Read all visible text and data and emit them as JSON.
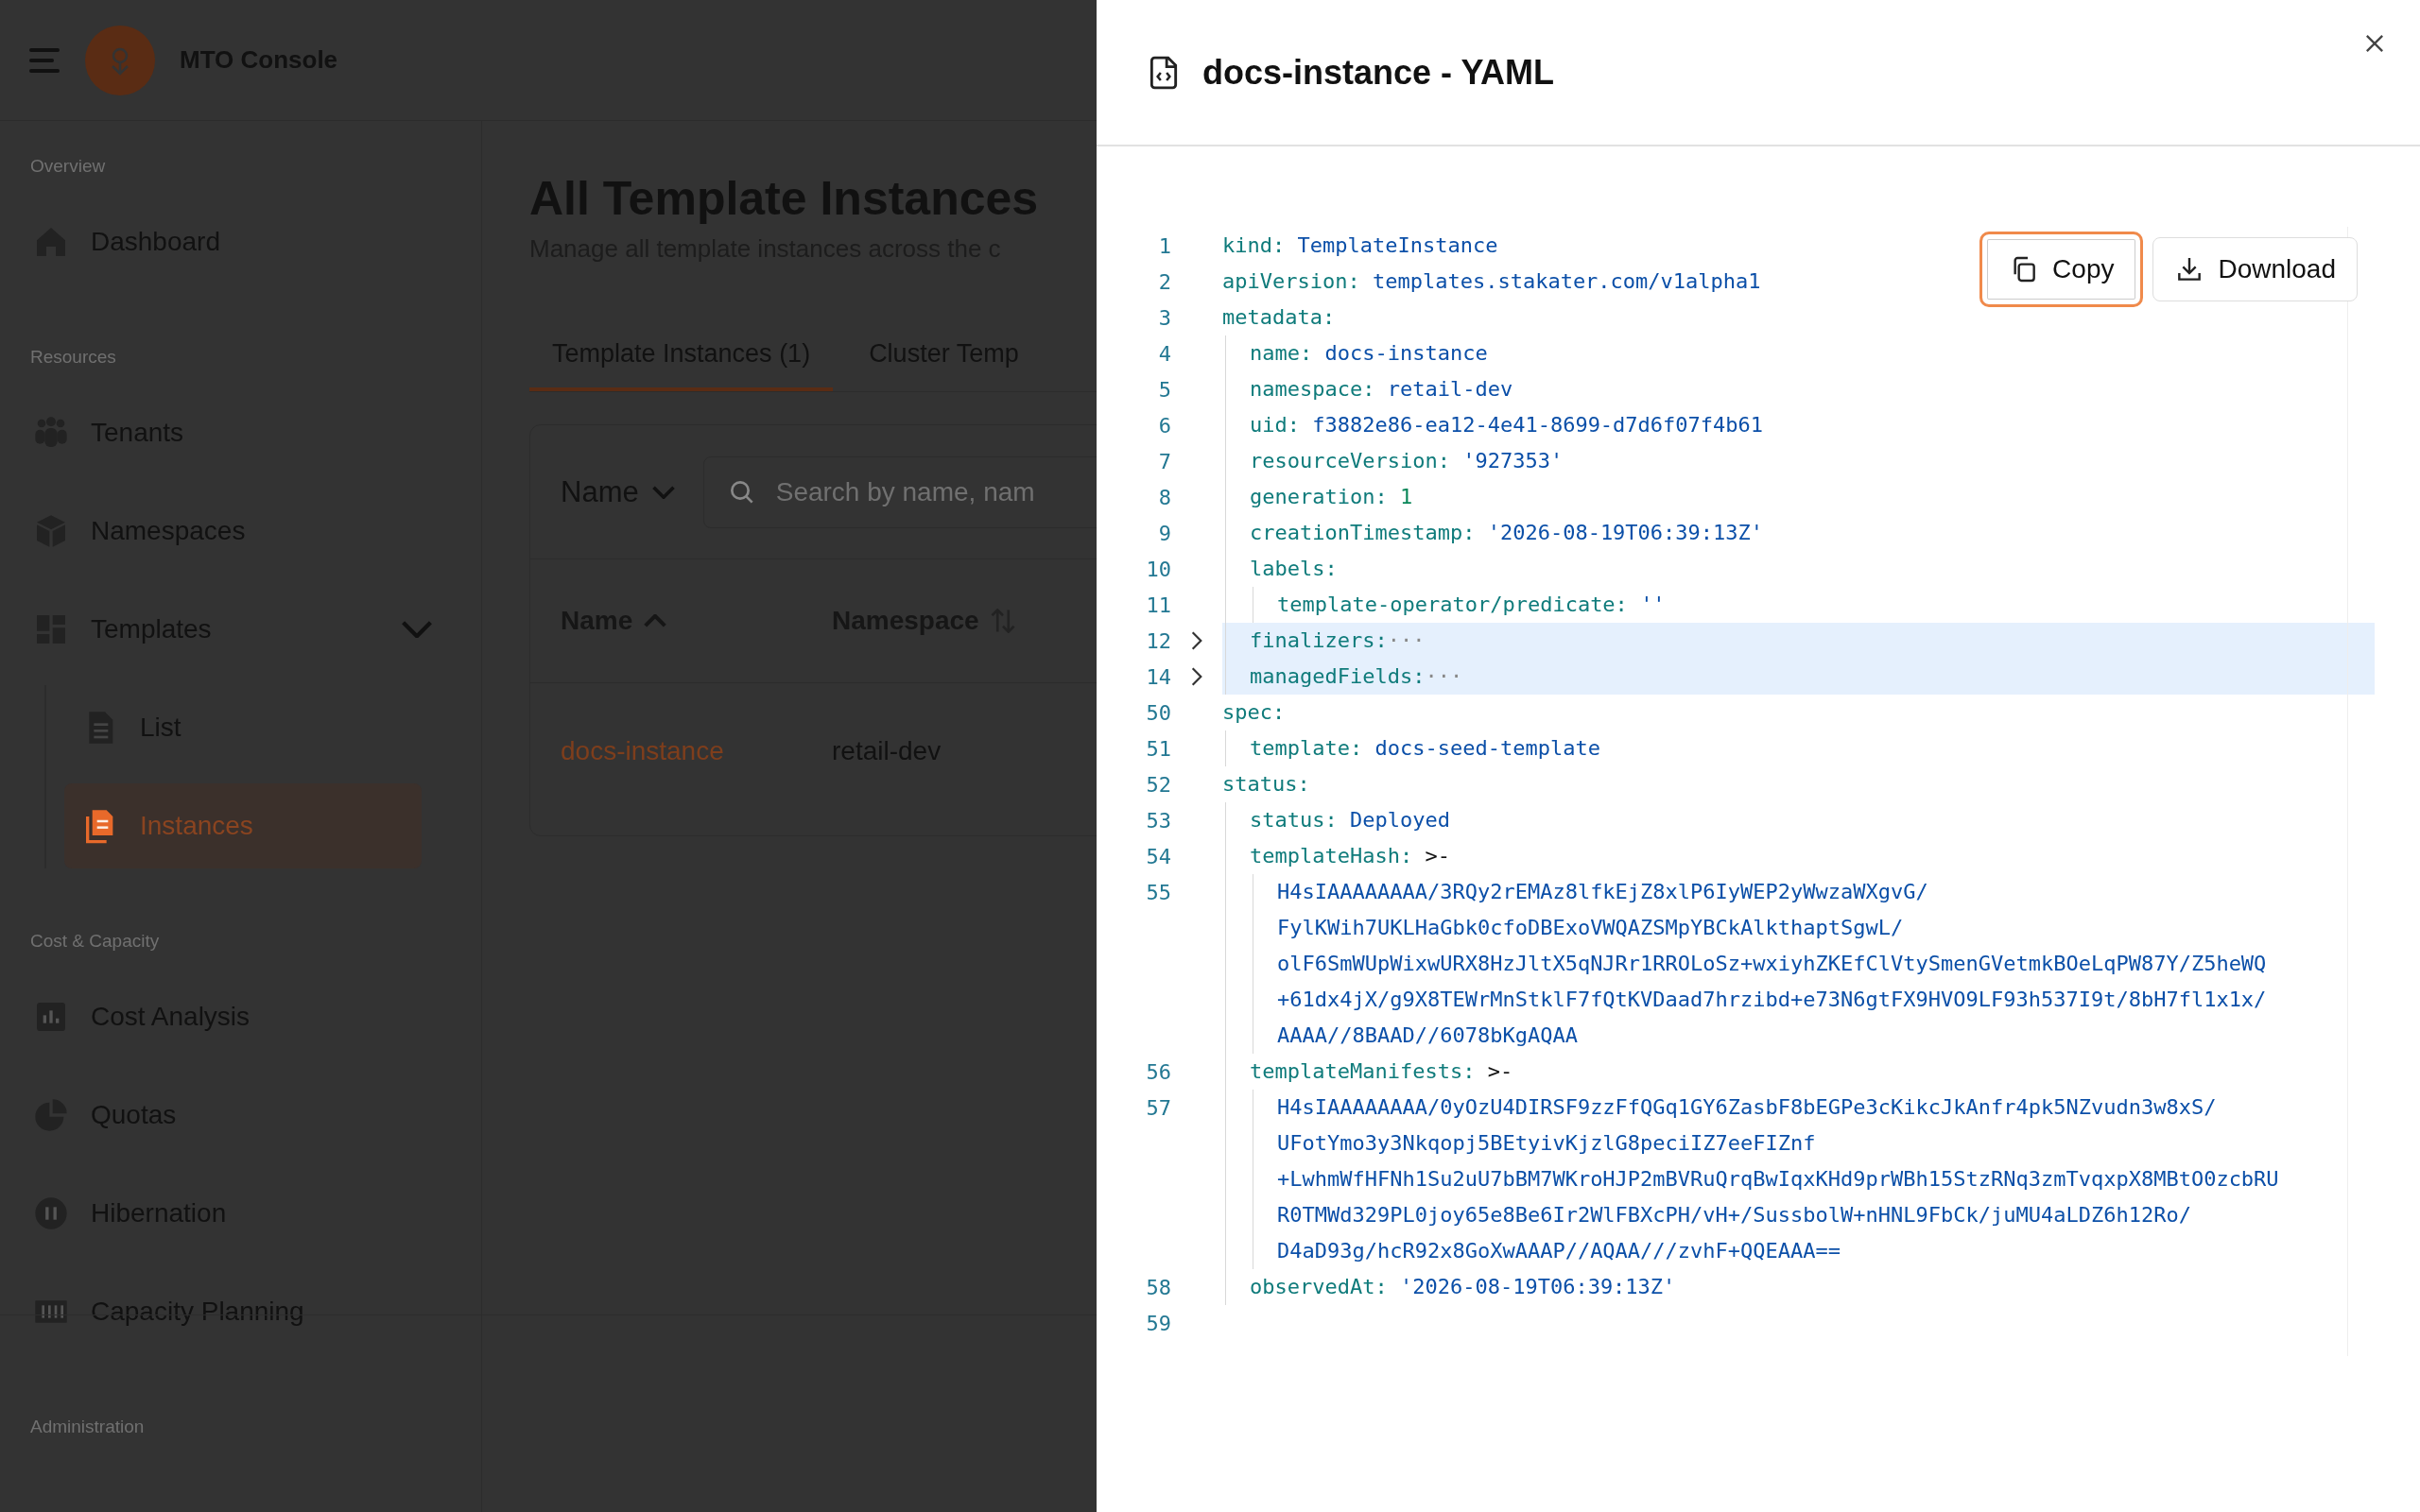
{
  "app": {
    "brand": "MTO Console",
    "sidebar": {
      "sections": [
        {
          "label": "Overview",
          "items": [
            {
              "label": "Dashboard",
              "selected": false
            }
          ]
        },
        {
          "label": "Resources",
          "items": [
            {
              "label": "Tenants",
              "selected": false
            },
            {
              "label": "Namespaces",
              "selected": false
            },
            {
              "label": "Templates",
              "selected": false,
              "expanded": true,
              "children": [
                {
                  "label": "List",
                  "selected": false
                },
                {
                  "label": "Instances",
                  "selected": true
                }
              ]
            }
          ]
        },
        {
          "label": "Cost & Capacity",
          "items": [
            {
              "label": "Cost Analysis",
              "selected": false
            },
            {
              "label": "Quotas",
              "selected": false
            },
            {
              "label": "Hibernation",
              "selected": false
            },
            {
              "label": "Capacity Planning",
              "selected": false
            }
          ]
        },
        {
          "label": "Administration"
        }
      ]
    },
    "page": {
      "title": "All Template Instances",
      "subtitle": "Manage all template instances across the c",
      "tabs": [
        {
          "label": "Template Instances (1)",
          "selected": true
        },
        {
          "label": "Cluster Temp",
          "selected": false
        }
      ],
      "filter": {
        "field": "Name",
        "search_placeholder": "Search by name, nam"
      },
      "table": {
        "columns": [
          {
            "label": "Name",
            "sorted": true
          },
          {
            "label": "Namespace",
            "sorted": false
          }
        ],
        "rows": [
          {
            "cells": [
              "docs-instance",
              "retail-dev"
            ]
          }
        ]
      }
    }
  },
  "drawer": {
    "title": "docs-instance - YAML",
    "buttons": [
      {
        "label": "Copy",
        "focused": true
      },
      {
        "label": "Download",
        "focused": false
      }
    ],
    "yaml": [
      {
        "number": "1",
        "key": "kind:",
        "value": "TemplateInstance",
        "kind": "string",
        "highlighted": false
      },
      {
        "number": "2",
        "key": "apiVersion:",
        "value": "templates.stakater.com/v1alpha1",
        "kind": "string",
        "highlighted": false
      },
      {
        "number": "3",
        "key": "metadata:",
        "highlighted": false,
        "collapsed": false,
        "children": [
          {
            "number": "4",
            "key": "name:",
            "value": "docs-instance",
            "kind": "string",
            "highlighted": false
          },
          {
            "number": "5",
            "key": "namespace:",
            "value": "retail-dev",
            "kind": "string",
            "highlighted": false
          },
          {
            "number": "6",
            "key": "uid:",
            "value": "f3882e86-ea12-4e41-8699-d7d6f07f4b61",
            "kind": "string",
            "highlighted": false
          },
          {
            "number": "7",
            "key": "resourceVersion:",
            "value": "'927353'",
            "kind": "string",
            "highlighted": false
          },
          {
            "number": "8",
            "key": "generation:",
            "value": "1",
            "kind": "number",
            "highlighted": false
          },
          {
            "number": "9",
            "key": "creationTimestamp:",
            "value": "'2026-08-19T06:39:13Z'",
            "kind": "string",
            "highlighted": false
          },
          {
            "number": "10",
            "key": "labels:",
            "highlighted": false,
            "collapsed": false,
            "children": [
              {
                "number": "11",
                "key": "template-operator/predicate:",
                "value": "''",
                "kind": "string",
                "highlighted": false
              }
            ]
          },
          {
            "number": "12",
            "key": "finalizers:",
            "ellipsis": "···",
            "highlighted": true,
            "collapsed": true
          },
          {
            "number": "14",
            "key": "managedFields:",
            "ellipsis": "···",
            "highlighted": true,
            "collapsed": true
          }
        ]
      },
      {
        "number": "50",
        "key": "spec:",
        "highlighted": false,
        "collapsed": false,
        "children": [
          {
            "number": "51",
            "key": "template:",
            "value": "docs-seed-template",
            "kind": "string",
            "highlighted": false
          }
        ]
      },
      {
        "number": "52",
        "key": "status:",
        "highlighted": false,
        "collapsed": false,
        "children": [
          {
            "number": "53",
            "key": "status:",
            "value": "Deployed",
            "kind": "string",
            "highlighted": false
          },
          {
            "number": "54",
            "key": "templateHash:",
            "value": ">-",
            "kind": "indicator",
            "highlighted": false,
            "collapsed": false,
            "children": [
              {
                "number": "55",
                "highlighted": false,
                "lines": [
                  "H4sIAAAAAAAA/3RQy2rEMAz8lfkEjZ8xlP6IyWEP2yWwzaWXgvG/",
                  "FylKWih7UKLHaGbk0cfoDBExoVWQAZSMpYBCkAlkthaptSgwL/",
                  "olF6SmWUpWixwURX8HzJltX5qNJRr1RROLoSz+wxiyhZKEfClVtySmenGVetmkBOeLqPW87Y/Z5heWQ",
                  "+61dx4jX/g9X8TEWrMnStklF7fQtKVDaad7hrzibd+e73N6gtFX9HVO9LF93h537I9t/8bH7fl1x1x/",
                  "AAAA//8BAAD//6078bKgAQAA"
                ]
              }
            ]
          },
          {
            "number": "56",
            "key": "templateManifests:",
            "value": ">-",
            "kind": "indicator",
            "highlighted": false,
            "collapsed": false,
            "children": [
              {
                "number": "57",
                "highlighted": false,
                "lines": [
                  "H4sIAAAAAAAA/0yOzU4DIRSF9zzFfQGq1GY6ZasbF8bEGPe3cKikcJkAnfr4pk5NZvudn3w8xS/",
                  "UFotYmo3y3Nkqopj5BEtyivKjzlG8peciIZ7eeFIZnf",
                  "+LwhmWfHFNh1Su2uU7bBM7WKroHJP2mBVRuQrqBwIqxKHd9prWBh15StzRNq3zmTvqxpX8MBtO0zcbRU",
                  "R0TMWd329PL0joy65e8Be6Ir2WlFBXcPH/vH+/SussbolW+nHNL9FbCk/juMU4aLDZ6h12Ro/",
                  "D4aD93g/hcR92x8GoXwAAAP//AQAA///zvhF+QQEAAA=="
                ]
              }
            ]
          },
          {
            "number": "58",
            "key": "observedAt:",
            "value": "'2026-08-19T06:39:13Z'",
            "kind": "string",
            "highlighted": false
          }
        ]
      },
      {
        "number": "59"
      }
    ]
  }
}
